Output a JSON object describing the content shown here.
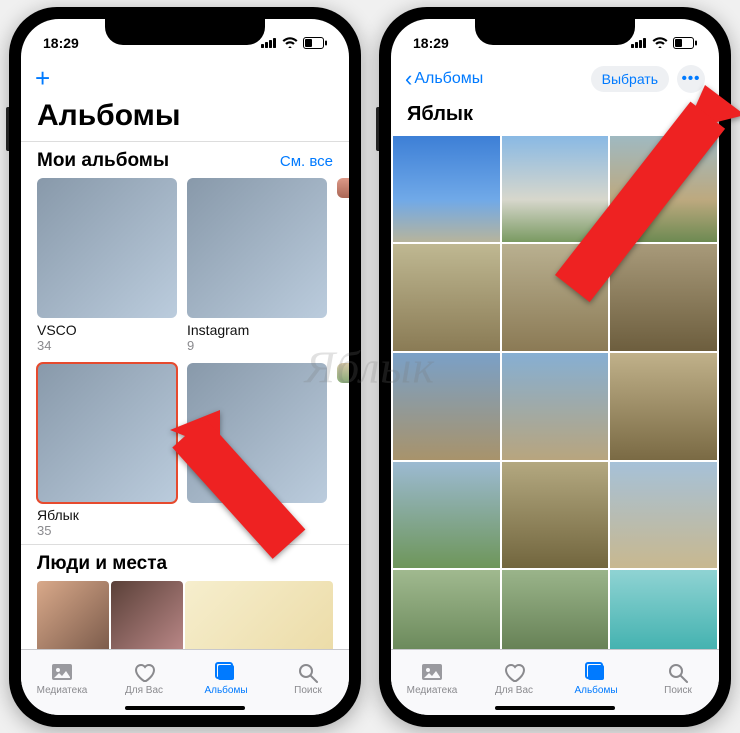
{
  "watermark": "Яблык",
  "statusbar": {
    "time": "18:29"
  },
  "left": {
    "title": "Альбомы",
    "section_my_albums": {
      "title": "Мои альбомы",
      "see_all": "См. все"
    },
    "albums": [
      {
        "name": "VSCO",
        "count": "34"
      },
      {
        "name": "Instagram",
        "count": "9"
      },
      {
        "name": "Яблык",
        "count": "35"
      },
      {
        "name": "",
        "count": ""
      }
    ],
    "section_people_places": {
      "title": "Люди и места"
    }
  },
  "right": {
    "back_label": "Альбомы",
    "select_label": "Выбрать",
    "album_title": "Яблык"
  },
  "tabs": {
    "library": "Медиатека",
    "for_you": "Для Вас",
    "albums": "Альбомы",
    "search": "Поиск"
  }
}
